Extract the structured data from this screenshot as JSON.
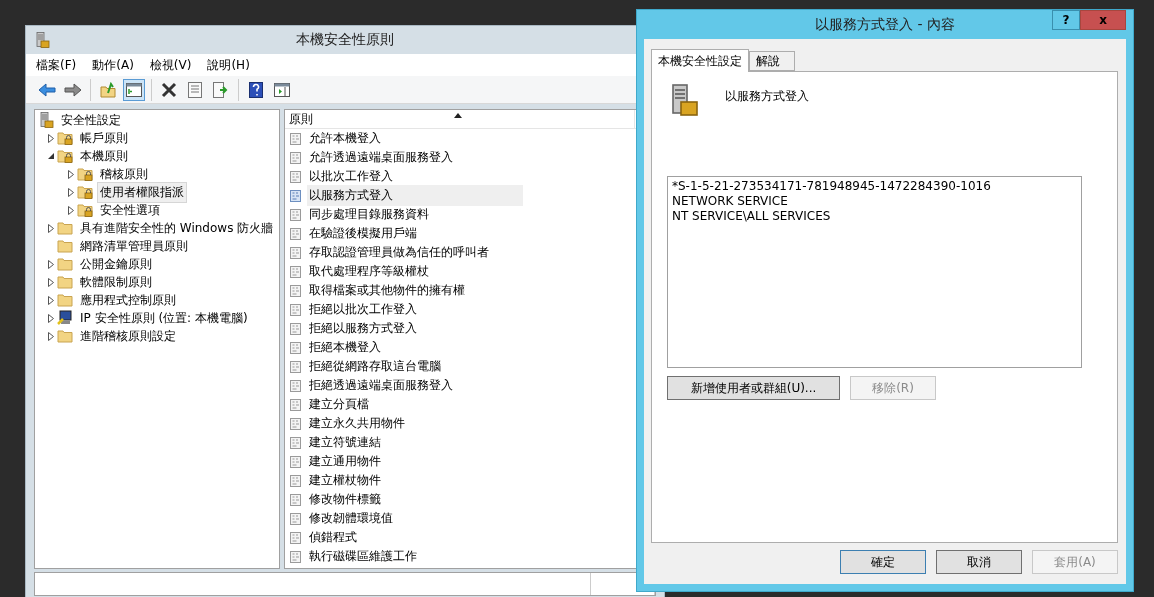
{
  "main_window": {
    "title": "本機安全性原則",
    "menu": [
      "檔案(F)",
      "動作(A)",
      "檢視(V)",
      "說明(H)"
    ],
    "toolbar": [
      [
        {
          "kind": "back",
          "pressed": false
        },
        {
          "kind": "forward",
          "pressed": false
        }
      ],
      [
        {
          "kind": "up",
          "pressed": false
        },
        {
          "kind": "tree-toggle",
          "pressed": true
        }
      ],
      [
        {
          "kind": "delete",
          "pressed": false
        },
        {
          "kind": "properties",
          "pressed": false
        },
        {
          "kind": "export",
          "pressed": false
        }
      ],
      [
        {
          "kind": "help",
          "pressed": false
        },
        {
          "kind": "panel",
          "pressed": false
        }
      ]
    ],
    "tree": [
      {
        "label": "安全性設定",
        "kind": "security-root",
        "selected": false,
        "children": [
          {
            "label": "帳戶原則",
            "kind": "lock-folder",
            "expandable": true,
            "expanded": false,
            "selected": false
          },
          {
            "label": "本機原則",
            "kind": "lock-folder",
            "expandable": true,
            "expanded": true,
            "selected": false,
            "children": [
              {
                "label": "稽核原則",
                "kind": "lock-folder",
                "expandable": true,
                "expanded": false,
                "selected": false
              },
              {
                "label": "使用者權限指派",
                "kind": "lock-folder",
                "expandable": true,
                "expanded": false,
                "selected": true
              },
              {
                "label": "安全性選項",
                "kind": "lock-folder",
                "expandable": true,
                "expanded": false,
                "selected": false
              }
            ]
          },
          {
            "label": "具有進階安全性的 Windows 防火牆",
            "kind": "folder",
            "expandable": true,
            "expanded": false,
            "selected": false
          },
          {
            "label": "網路清單管理員原則",
            "kind": "folder",
            "expandable": false,
            "selected": false
          },
          {
            "label": "公開金鑰原則",
            "kind": "folder",
            "expandable": true,
            "expanded": false,
            "selected": false
          },
          {
            "label": "軟體限制原則",
            "kind": "folder",
            "expandable": true,
            "expanded": false,
            "selected": false
          },
          {
            "label": "應用程式控制原則",
            "kind": "folder",
            "expandable": true,
            "expanded": false,
            "selected": false
          },
          {
            "label": "IP 安全性原則 (位置: 本機電腦)",
            "kind": "ip-policy",
            "expandable": true,
            "expanded": false,
            "selected": false
          },
          {
            "label": "進階稽核原則設定",
            "kind": "folder",
            "expandable": true,
            "expanded": false,
            "selected": false
          }
        ]
      }
    ],
    "policies": {
      "column": "原則",
      "rows": [
        {
          "name": "允許本機登入",
          "selected": false
        },
        {
          "name": "允許透過遠端桌面服務登入",
          "selected": false
        },
        {
          "name": "以批次工作登入",
          "selected": false
        },
        {
          "name": "以服務方式登入",
          "selected": true
        },
        {
          "name": "同步處理目錄服務資料",
          "selected": false
        },
        {
          "name": "在驗證後模擬用戶端",
          "selected": false
        },
        {
          "name": "存取認證管理員做為信任的呼叫者",
          "selected": false
        },
        {
          "name": "取代處理程序等級權杖",
          "selected": false
        },
        {
          "name": "取得檔案或其他物件的擁有權",
          "selected": false
        },
        {
          "name": "拒絕以批次工作登入",
          "selected": false
        },
        {
          "name": "拒絕以服務方式登入",
          "selected": false
        },
        {
          "name": "拒絕本機登入",
          "selected": false
        },
        {
          "name": "拒絕從網路存取這台電腦",
          "selected": false
        },
        {
          "name": "拒絕透過遠端桌面服務登入",
          "selected": false
        },
        {
          "name": "建立分頁檔",
          "selected": false
        },
        {
          "name": "建立永久共用物件",
          "selected": false
        },
        {
          "name": "建立符號連結",
          "selected": false
        },
        {
          "name": "建立通用物件",
          "selected": false
        },
        {
          "name": "建立權杖物件",
          "selected": false
        },
        {
          "name": "修改物件標籤",
          "selected": false
        },
        {
          "name": "修改韌體環境值",
          "selected": false
        },
        {
          "name": "偵錯程式",
          "selected": false
        },
        {
          "name": "執行磁碟區維護工作",
          "selected": false
        }
      ]
    }
  },
  "dialog": {
    "title": "以服務方式登入 - 內容",
    "help_button": "?",
    "close_button": "x",
    "tabs": [
      {
        "label": "本機安全性設定",
        "selected": true
      },
      {
        "label": "解說",
        "selected": false
      }
    ],
    "policy_name": "以服務方式登入",
    "accounts": [
      "*S-1-5-21-273534171-781948945-1472284390-1016",
      "NETWORK SERVICE",
      "NT SERVICE\\ALL SERVICES"
    ],
    "actions": [
      {
        "label": "新增使用者或群組(U)...",
        "disabled": false
      },
      {
        "label": "移除(R)",
        "disabled": true
      }
    ],
    "buttons": [
      {
        "label": "確定",
        "default": true,
        "disabled": false
      },
      {
        "label": "取消",
        "default": false,
        "disabled": false
      },
      {
        "label": "套用(A)",
        "default": false,
        "disabled": true
      }
    ]
  }
}
